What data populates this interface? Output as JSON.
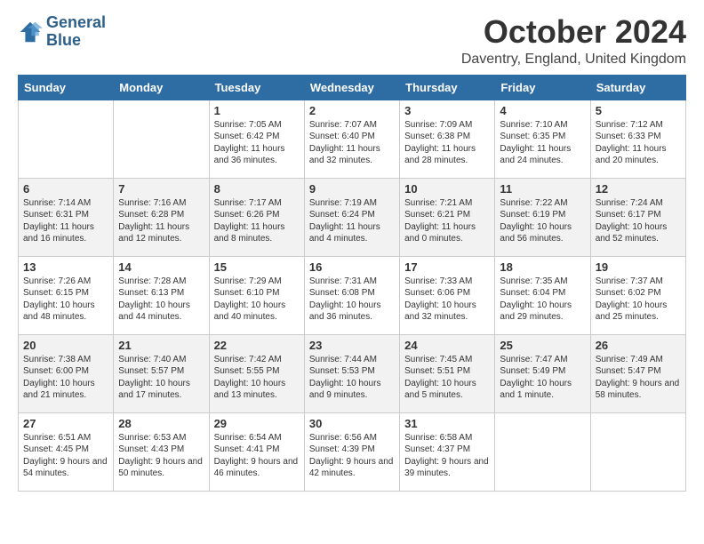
{
  "logo": {
    "line1": "General",
    "line2": "Blue"
  },
  "title": "October 2024",
  "subtitle": "Daventry, England, United Kingdom",
  "days_of_week": [
    "Sunday",
    "Monday",
    "Tuesday",
    "Wednesday",
    "Thursday",
    "Friday",
    "Saturday"
  ],
  "weeks": [
    [
      {
        "day": "",
        "info": ""
      },
      {
        "day": "",
        "info": ""
      },
      {
        "day": "1",
        "info": "Sunrise: 7:05 AM\nSunset: 6:42 PM\nDaylight: 11 hours and 36 minutes."
      },
      {
        "day": "2",
        "info": "Sunrise: 7:07 AM\nSunset: 6:40 PM\nDaylight: 11 hours and 32 minutes."
      },
      {
        "day": "3",
        "info": "Sunrise: 7:09 AM\nSunset: 6:38 PM\nDaylight: 11 hours and 28 minutes."
      },
      {
        "day": "4",
        "info": "Sunrise: 7:10 AM\nSunset: 6:35 PM\nDaylight: 11 hours and 24 minutes."
      },
      {
        "day": "5",
        "info": "Sunrise: 7:12 AM\nSunset: 6:33 PM\nDaylight: 11 hours and 20 minutes."
      }
    ],
    [
      {
        "day": "6",
        "info": "Sunrise: 7:14 AM\nSunset: 6:31 PM\nDaylight: 11 hours and 16 minutes."
      },
      {
        "day": "7",
        "info": "Sunrise: 7:16 AM\nSunset: 6:28 PM\nDaylight: 11 hours and 12 minutes."
      },
      {
        "day": "8",
        "info": "Sunrise: 7:17 AM\nSunset: 6:26 PM\nDaylight: 11 hours and 8 minutes."
      },
      {
        "day": "9",
        "info": "Sunrise: 7:19 AM\nSunset: 6:24 PM\nDaylight: 11 hours and 4 minutes."
      },
      {
        "day": "10",
        "info": "Sunrise: 7:21 AM\nSunset: 6:21 PM\nDaylight: 11 hours and 0 minutes."
      },
      {
        "day": "11",
        "info": "Sunrise: 7:22 AM\nSunset: 6:19 PM\nDaylight: 10 hours and 56 minutes."
      },
      {
        "day": "12",
        "info": "Sunrise: 7:24 AM\nSunset: 6:17 PM\nDaylight: 10 hours and 52 minutes."
      }
    ],
    [
      {
        "day": "13",
        "info": "Sunrise: 7:26 AM\nSunset: 6:15 PM\nDaylight: 10 hours and 48 minutes."
      },
      {
        "day": "14",
        "info": "Sunrise: 7:28 AM\nSunset: 6:13 PM\nDaylight: 10 hours and 44 minutes."
      },
      {
        "day": "15",
        "info": "Sunrise: 7:29 AM\nSunset: 6:10 PM\nDaylight: 10 hours and 40 minutes."
      },
      {
        "day": "16",
        "info": "Sunrise: 7:31 AM\nSunset: 6:08 PM\nDaylight: 10 hours and 36 minutes."
      },
      {
        "day": "17",
        "info": "Sunrise: 7:33 AM\nSunset: 6:06 PM\nDaylight: 10 hours and 32 minutes."
      },
      {
        "day": "18",
        "info": "Sunrise: 7:35 AM\nSunset: 6:04 PM\nDaylight: 10 hours and 29 minutes."
      },
      {
        "day": "19",
        "info": "Sunrise: 7:37 AM\nSunset: 6:02 PM\nDaylight: 10 hours and 25 minutes."
      }
    ],
    [
      {
        "day": "20",
        "info": "Sunrise: 7:38 AM\nSunset: 6:00 PM\nDaylight: 10 hours and 21 minutes."
      },
      {
        "day": "21",
        "info": "Sunrise: 7:40 AM\nSunset: 5:57 PM\nDaylight: 10 hours and 17 minutes."
      },
      {
        "day": "22",
        "info": "Sunrise: 7:42 AM\nSunset: 5:55 PM\nDaylight: 10 hours and 13 minutes."
      },
      {
        "day": "23",
        "info": "Sunrise: 7:44 AM\nSunset: 5:53 PM\nDaylight: 10 hours and 9 minutes."
      },
      {
        "day": "24",
        "info": "Sunrise: 7:45 AM\nSunset: 5:51 PM\nDaylight: 10 hours and 5 minutes."
      },
      {
        "day": "25",
        "info": "Sunrise: 7:47 AM\nSunset: 5:49 PM\nDaylight: 10 hours and 1 minute."
      },
      {
        "day": "26",
        "info": "Sunrise: 7:49 AM\nSunset: 5:47 PM\nDaylight: 9 hours and 58 minutes."
      }
    ],
    [
      {
        "day": "27",
        "info": "Sunrise: 6:51 AM\nSunset: 4:45 PM\nDaylight: 9 hours and 54 minutes."
      },
      {
        "day": "28",
        "info": "Sunrise: 6:53 AM\nSunset: 4:43 PM\nDaylight: 9 hours and 50 minutes."
      },
      {
        "day": "29",
        "info": "Sunrise: 6:54 AM\nSunset: 4:41 PM\nDaylight: 9 hours and 46 minutes."
      },
      {
        "day": "30",
        "info": "Sunrise: 6:56 AM\nSunset: 4:39 PM\nDaylight: 9 hours and 42 minutes."
      },
      {
        "day": "31",
        "info": "Sunrise: 6:58 AM\nSunset: 4:37 PM\nDaylight: 9 hours and 39 minutes."
      },
      {
        "day": "",
        "info": ""
      },
      {
        "day": "",
        "info": ""
      }
    ]
  ]
}
